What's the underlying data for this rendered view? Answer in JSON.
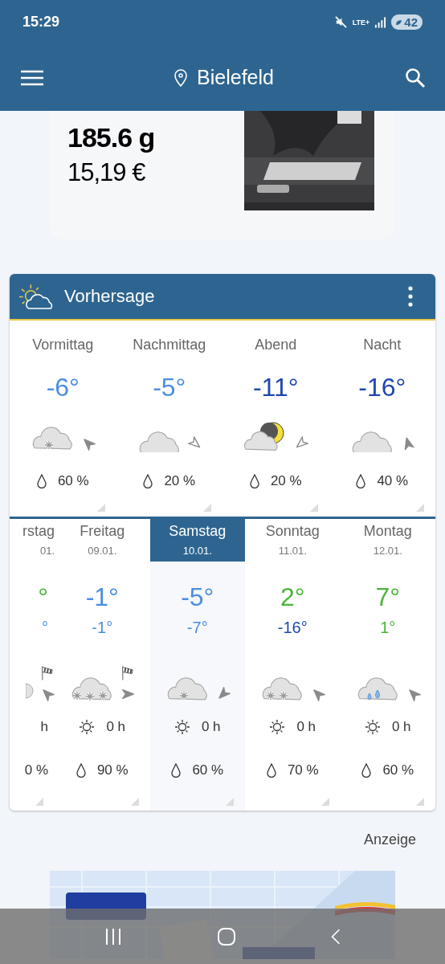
{
  "status_bar": {
    "time": "15:29",
    "network": "LTE+",
    "battery": "42"
  },
  "app_bar": {
    "location": "Bielefeld"
  },
  "product": {
    "name": "185.6 g",
    "price": "15,19 €"
  },
  "forecast": {
    "title": "Vorhersage",
    "day_parts": [
      {
        "label": "Vormittag",
        "temp": {
          "text": "-6°",
          "color": "#4a8ee0"
        },
        "icon": {
          "kind": "snow"
        },
        "wind": {
          "kind": "nw"
        },
        "rain": "60 %"
      },
      {
        "label": "Nachmittag",
        "temp": {
          "text": "-5°",
          "color": "#4a8ee0"
        },
        "icon": {
          "kind": "cloud"
        },
        "wind": {
          "kind": "outlinese"
        },
        "rain": "20 %"
      },
      {
        "label": "Abend",
        "temp": {
          "text": "-11°",
          "color": "#1f47ad"
        },
        "icon": {
          "kind": "moon"
        },
        "wind": {
          "kind": "outlinesw"
        },
        "rain": "20 %"
      },
      {
        "label": "Nacht",
        "temp": {
          "text": "-16°",
          "color": "#1f47ad"
        },
        "icon": {
          "kind": "cloud"
        },
        "wind": {
          "kind": "n"
        },
        "rain": "40 %"
      }
    ],
    "days": [
      {
        "day": "rstag",
        "date": "01.",
        "high": {
          "text": "°",
          "color": "#4cb53a"
        },
        "low": {
          "text": "°",
          "color": "#4a8ee0"
        },
        "icon": {
          "kind": "partial"
        },
        "wind": {
          "kind": "nw"
        },
        "gust": true,
        "sun": "h",
        "rain": "0 %",
        "selected": false,
        "clipped": true
      },
      {
        "day": "Freitag",
        "date": "09.01.",
        "high": {
          "text": "-1°",
          "color": "#4a8ee0"
        },
        "low": {
          "text": "-1°",
          "color": "#4a8ee0"
        },
        "icon": {
          "kind": "heavysnow"
        },
        "wind": {
          "kind": "e"
        },
        "gust": true,
        "sun": "0 h",
        "rain": "90 %",
        "selected": false,
        "clipped": false
      },
      {
        "day": "Samstag",
        "date": "10.01.",
        "high": {
          "text": "-5°",
          "color": "#4a8ee0"
        },
        "low": {
          "text": "-7°",
          "color": "#4a8ee0"
        },
        "icon": {
          "kind": "snow"
        },
        "wind": {
          "kind": "sw"
        },
        "gust": false,
        "sun": "0 h",
        "rain": "60 %",
        "selected": true,
        "clipped": false
      },
      {
        "day": "Sonntag",
        "date": "11.01.",
        "high": {
          "text": "2°",
          "color": "#4cb53a"
        },
        "low": {
          "text": "-16°",
          "color": "#1f47ad"
        },
        "icon": {
          "kind": "snow2"
        },
        "wind": {
          "kind": "nw"
        },
        "gust": false,
        "sun": "0 h",
        "rain": "70 %",
        "selected": false,
        "clipped": false
      },
      {
        "day": "Montag",
        "date": "12.01.",
        "high": {
          "text": "7°",
          "color": "#4cb53a"
        },
        "low": {
          "text": "1°",
          "color": "#4cb53a"
        },
        "icon": {
          "kind": "rain"
        },
        "wind": {
          "kind": "nw"
        },
        "gust": false,
        "sun": "0 h",
        "rain": "60 %",
        "selected": false,
        "clipped": false
      }
    ]
  },
  "ad": {
    "label": "Anzeige"
  }
}
